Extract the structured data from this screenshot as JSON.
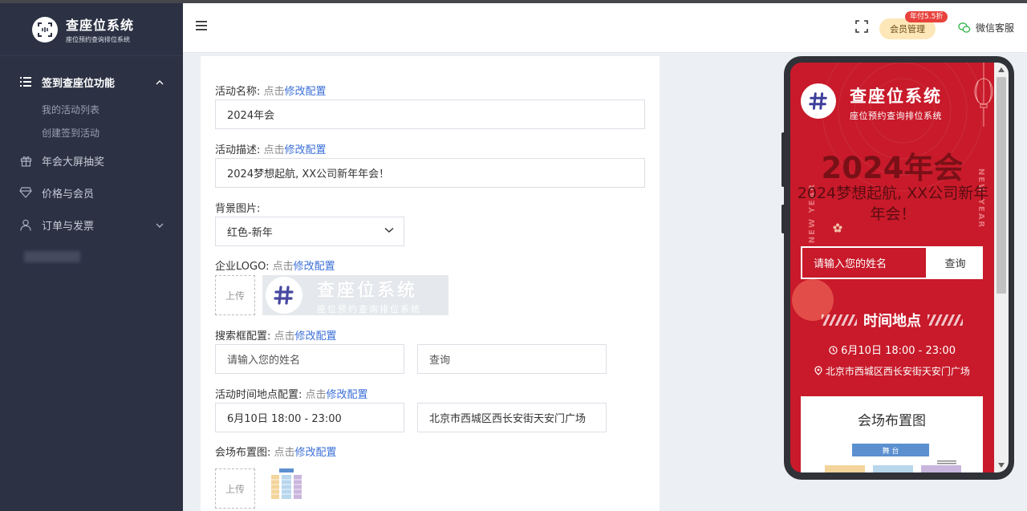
{
  "brand": {
    "title": "查座位系统",
    "subtitle": "座位预约查询排位系统"
  },
  "sidebar": {
    "items": [
      {
        "label": "签到查座位功能",
        "active": true,
        "expanded": true,
        "children": [
          "我的活动列表",
          "创建签到活动"
        ]
      },
      {
        "label": "年会大屏抽奖"
      },
      {
        "label": "价格与会员"
      },
      {
        "label": "订单与发票"
      }
    ]
  },
  "header": {
    "vip_label": "会员管理",
    "vip_badge": "年付5.5折",
    "wechat_label": "微信客服"
  },
  "form": {
    "hint_prefix": "点击",
    "hint_link": "修改配置",
    "activity_name_label": "活动名称:",
    "activity_name_value": "2024年会",
    "activity_desc_label": "活动描述:",
    "activity_desc_value": "2024梦想起航, XX公司新年年会！",
    "bg_label": "背景图片:",
    "bg_value": "红色-新年",
    "logo_label": "企业LOGO:",
    "upload_label": "上传",
    "search_label": "搜索框配置:",
    "search_placeholder": "请输入您的姓名",
    "search_button": "查询",
    "time_place_label": "活动时间地点配置:",
    "time_value": "6月10日 18:00 - 23:00",
    "place_value": "北京市西城区西长安街天安门广场",
    "layout_label": "会场布置图:"
  },
  "phone": {
    "brand_title": "查座位系统",
    "brand_subtitle": "座位预约查询排位系统",
    "title": "2024年会",
    "desc": "2024梦想起航, XX公司新年年会！",
    "new_year": "NEW YEAR",
    "search_placeholder": "请输入您的姓名",
    "search_button": "查询",
    "section_title": "时间地点",
    "time": "6月10日 18:00 - 23:00",
    "address": "北京市西城区西长安街天安门广场",
    "layout_title": "会场布置图",
    "stage_label": "舞 台"
  },
  "colors": {
    "sidebar_bg": "#2c3244",
    "accent_red": "#c81a2a",
    "link_blue": "#3b6fd8",
    "vip_bg": "#fde7b8",
    "badge_red": "#e8423d",
    "wechat_green": "#2db34a"
  }
}
